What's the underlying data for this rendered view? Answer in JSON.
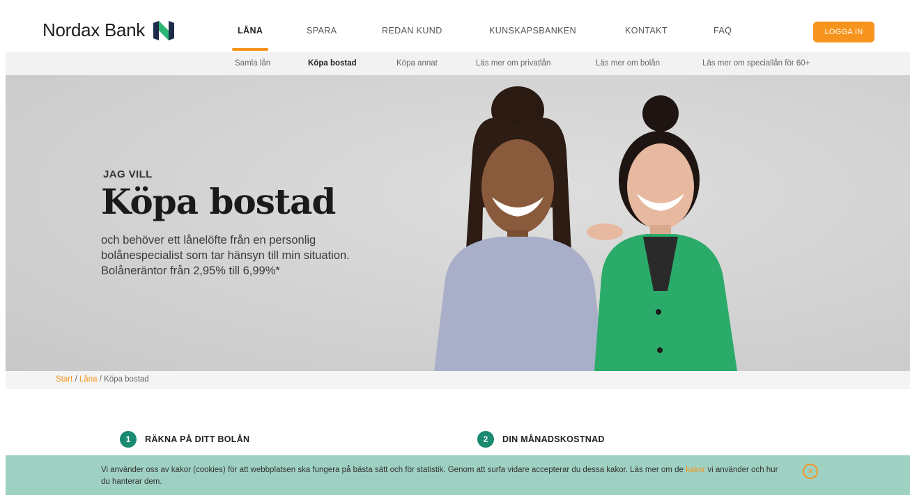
{
  "header": {
    "brand": "Nordax Bank",
    "nav": [
      {
        "label": "LÅNA",
        "active": true
      },
      {
        "label": "SPARA",
        "active": false
      },
      {
        "label": "REDAN KUND",
        "active": false
      },
      {
        "label": "KUNSKAPSBANKEN",
        "active": false
      },
      {
        "label": "KONTAKT",
        "active": false
      },
      {
        "label": "FAQ",
        "active": false
      }
    ],
    "login_label": "LOGGA IN"
  },
  "subnav": [
    {
      "label": "Samla lån",
      "active": false
    },
    {
      "label": "Köpa bostad",
      "active": true
    },
    {
      "label": "Köpa annat",
      "active": false
    },
    {
      "label": "Läs mer om privatlån",
      "active": false
    },
    {
      "label": "Läs mer om bolån",
      "active": false
    },
    {
      "label": "Läs mer om speciallån för 60+",
      "active": false
    }
  ],
  "hero": {
    "eyebrow": "JAG VILL",
    "title": "Köpa bostad",
    "body_line1": "och behöver ett lånelöfte från en personlig",
    "body_line2": "bolånespecialist som tar hänsyn till min situation.",
    "body_line3": "Bolåneräntor från 2,95% till 6,99%*"
  },
  "breadcrumb": {
    "items": [
      "Start",
      "Låna"
    ],
    "separator": "/",
    "current": "Köpa bostad"
  },
  "steps": [
    {
      "number": "1",
      "label": "RÄKNA PÅ DITT BOLÅN"
    },
    {
      "number": "2",
      "label": "DIN MÅNADSKOSTNAD"
    }
  ],
  "cookie": {
    "text_before": "Vi använder oss av kakor (cookies) för att webbplatsen ska fungera på bästa sätt och för statistik. Genom att surfa vidare accepterar du dessa kakor. Läs mer om de ",
    "link": "kakor",
    "text_after": " vi använder och hur du hanterar dem.",
    "close_symbol": "×"
  },
  "colors": {
    "accent": "#f7941d",
    "teal": "#1a8a70",
    "cookie_bg": "#9fd1c3",
    "logo_navy": "#1c2b4a",
    "logo_green": "#2bb673"
  },
  "icons": {
    "logo": "nordax-n-logo-icon",
    "close": "close-circle-icon"
  }
}
